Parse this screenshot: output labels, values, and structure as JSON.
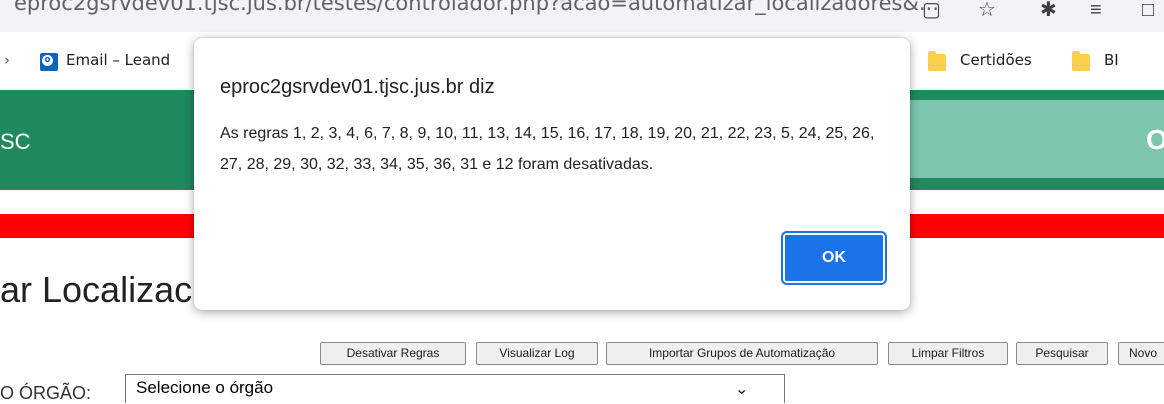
{
  "browser": {
    "url": "eproc2gsrvdev01.tjsc.jus.br/testes/controlador.php?acao=automatizar_localizadores&..."
  },
  "bookmarks": {
    "email_label": "Email – Leand",
    "certidoes_label": "Certidões",
    "bi_label": "BI"
  },
  "page": {
    "brand": "SC",
    "right_letter": "O",
    "title": "ar Localizac",
    "buttons": {
      "desativar": "Desativar Regras",
      "visualizar_log": "Visualizar Log",
      "importar": "Importar Grupos de Automatização",
      "limpar": "Limpar Filtros",
      "pesquisar": "Pesquisar",
      "novo": "Novo"
    },
    "orgao_label": "O ÓRGÃO:",
    "orgao_select": "Selecione o órgão"
  },
  "dialog": {
    "title": "eproc2gsrvdev01.tjsc.jus.br diz",
    "message": "As regras 1, 2, 3, 4, 6, 7, 8, 9, 10, 11, 13, 14, 15, 16, 17, 18, 19, 20, 21, 22, 23, 5, 24, 25, 26, 27, 28, 29, 30, 32, 33, 34, 35, 36, 31 e 12 foram desativadas.",
    "ok_label": "OK"
  },
  "colors": {
    "green_bar": "#1e8a5e",
    "green_light": "#7cc6ae",
    "red_bar": "#ff0000",
    "ok_blue": "#1a73e8"
  }
}
